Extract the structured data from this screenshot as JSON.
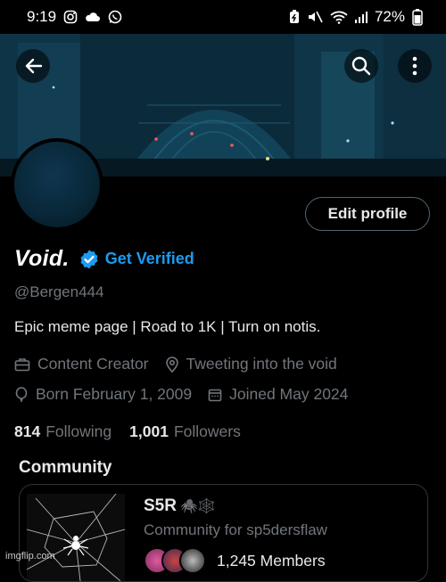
{
  "status_bar": {
    "time": "9:19",
    "battery": "72%"
  },
  "profile": {
    "display_name": "Void.",
    "get_verified": "Get Verified",
    "handle": "@Bergen444",
    "bio": "Epic meme page | Road to 1K | Turn on notis.",
    "category": "Content Creator",
    "location": "Tweeting into the void",
    "born": "Born February 1, 2009",
    "joined": "Joined May 2024",
    "following_count": "814",
    "following_label": "Following",
    "followers_count": "1,001",
    "followers_label": "Followers",
    "edit_button": "Edit profile"
  },
  "community": {
    "section_title": "Community",
    "name": "S5R",
    "name_emojis": "🕷️🕸️",
    "description": "Community for sp5dersflaw",
    "members": "1,245 Members"
  },
  "watermark": "imgflip.com",
  "icons": {
    "back": "back-arrow-icon",
    "search": "search-icon",
    "more": "more-vertical-icon",
    "verified": "verified-badge-icon",
    "category": "briefcase-icon",
    "location": "location-pin-icon",
    "birthday": "balloon-icon",
    "joined": "calendar-icon"
  },
  "colors": {
    "accent": "#1d9bf0",
    "muted": "#71767b",
    "text": "#e7e9ea",
    "background": "#000000"
  }
}
